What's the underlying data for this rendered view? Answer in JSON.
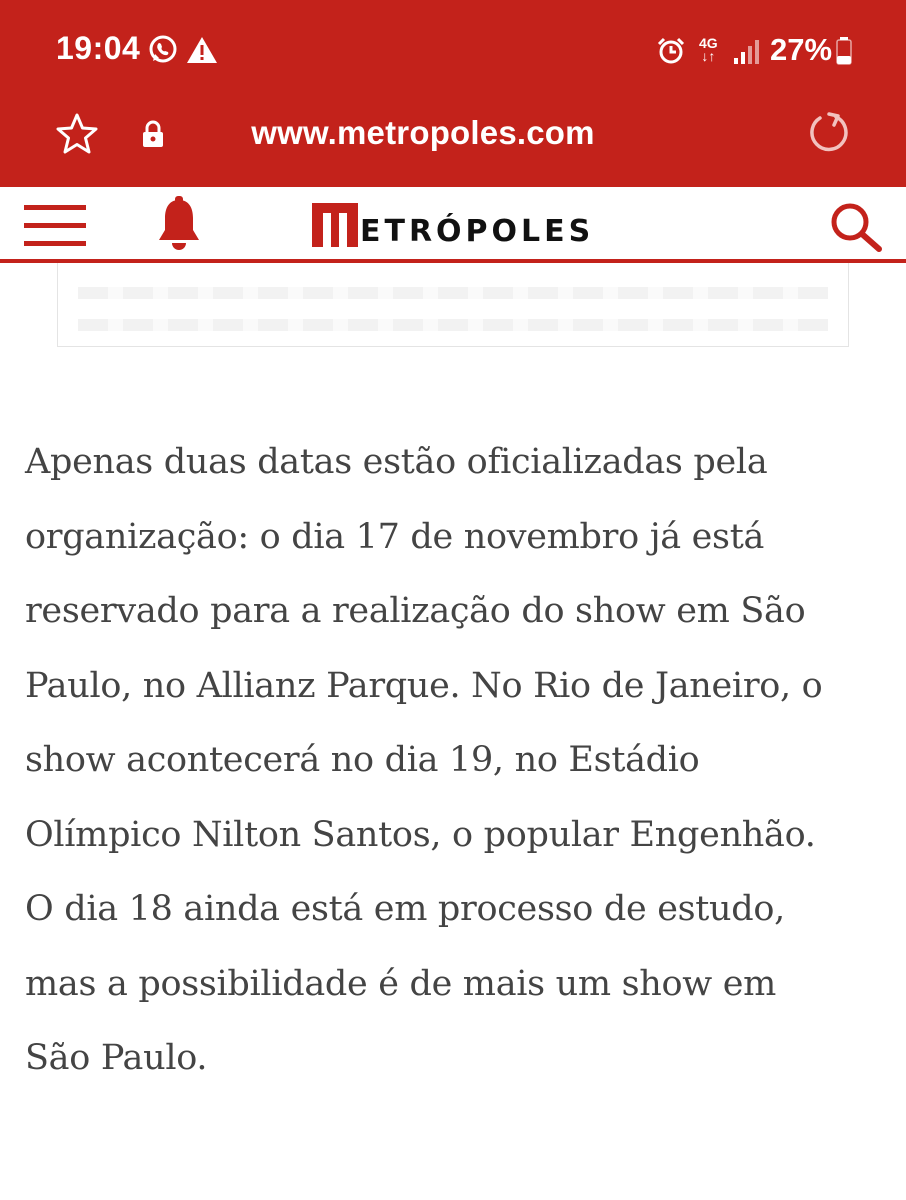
{
  "status_bar": {
    "time": "19:04",
    "battery_text": "27%",
    "network": "4G"
  },
  "browser": {
    "url": "www.metropoles.com"
  },
  "site": {
    "brand_text": "ETRÓPOLES",
    "brand_color": "#c3221b"
  },
  "article": {
    "lines": [
      "Apenas duas datas estão oficializadas pela",
      "organização: o dia 17 de novembro já está",
      "reservado para a realização do show em São",
      "Paulo, no Allianz Parque. No Rio de Janeiro, o",
      "show acontecerá no dia 19, no Estádio",
      "Olímpico Nilton Santos, o popular Engenhão.",
      "O dia 18 ainda está em processo de estudo,",
      "mas a possibilidade é de mais um show em",
      "São Paulo."
    ]
  }
}
